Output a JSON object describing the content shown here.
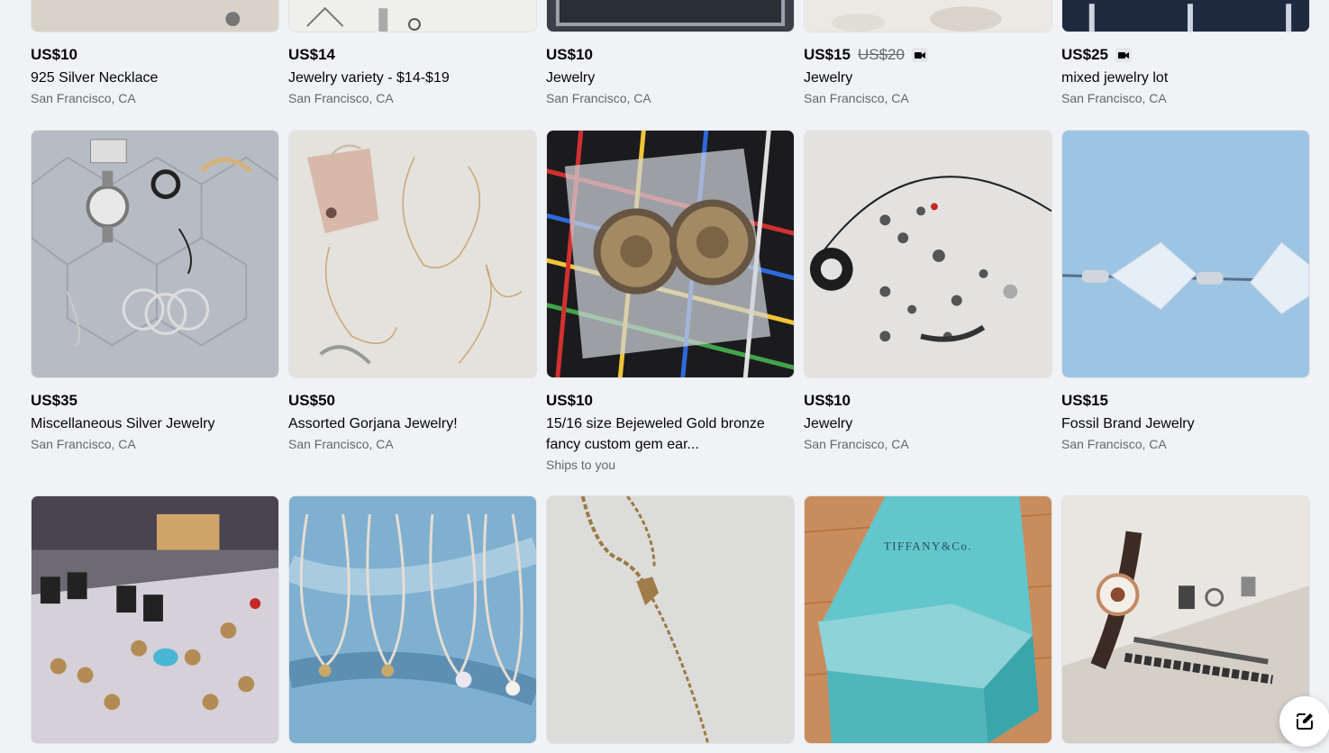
{
  "row1": [
    {
      "price": "US$10",
      "old_price": "",
      "video": false,
      "title": "925 Silver Necklace",
      "location": "San Francisco, CA"
    },
    {
      "price": "US$14",
      "old_price": "",
      "video": false,
      "title": "Jewelry variety - $14-$19",
      "location": "San Francisco, CA"
    },
    {
      "price": "US$10",
      "old_price": "",
      "video": false,
      "title": "Jewelry",
      "location": "San Francisco, CA"
    },
    {
      "price": "US$15",
      "old_price": "US$20",
      "video": true,
      "title": "Jewelry",
      "location": "San Francisco, CA"
    },
    {
      "price": "US$25",
      "old_price": "",
      "video": true,
      "title": "mixed jewelry lot",
      "location": "San Francisco, CA"
    }
  ],
  "row2": [
    {
      "price": "US$35",
      "title": "Miscellaneous Silver Jewelry",
      "location": "San Francisco, CA"
    },
    {
      "price": "US$50",
      "title": "Assorted Gorjana Jewelry!",
      "location": "San Francisco, CA"
    },
    {
      "price": "US$10",
      "title": "15/16 size Bejeweled Gold bronze fancy custom gem ear...",
      "location": "Ships to you"
    },
    {
      "price": "US$10",
      "title": "Jewelry",
      "location": "San Francisco, CA"
    },
    {
      "price": "US$15",
      "title": "Fossil Brand Jewelry",
      "location": "San Francisco, CA"
    }
  ],
  "row3_images": {
    "box_brand": "TIFFANY&Co."
  },
  "icons": {
    "video": "video-camera-icon",
    "compose": "compose-icon"
  },
  "colors": {
    "background": "#f0f2f5",
    "secondary_text": "#65676b",
    "tiffany_blue": "#5fc5c9"
  }
}
